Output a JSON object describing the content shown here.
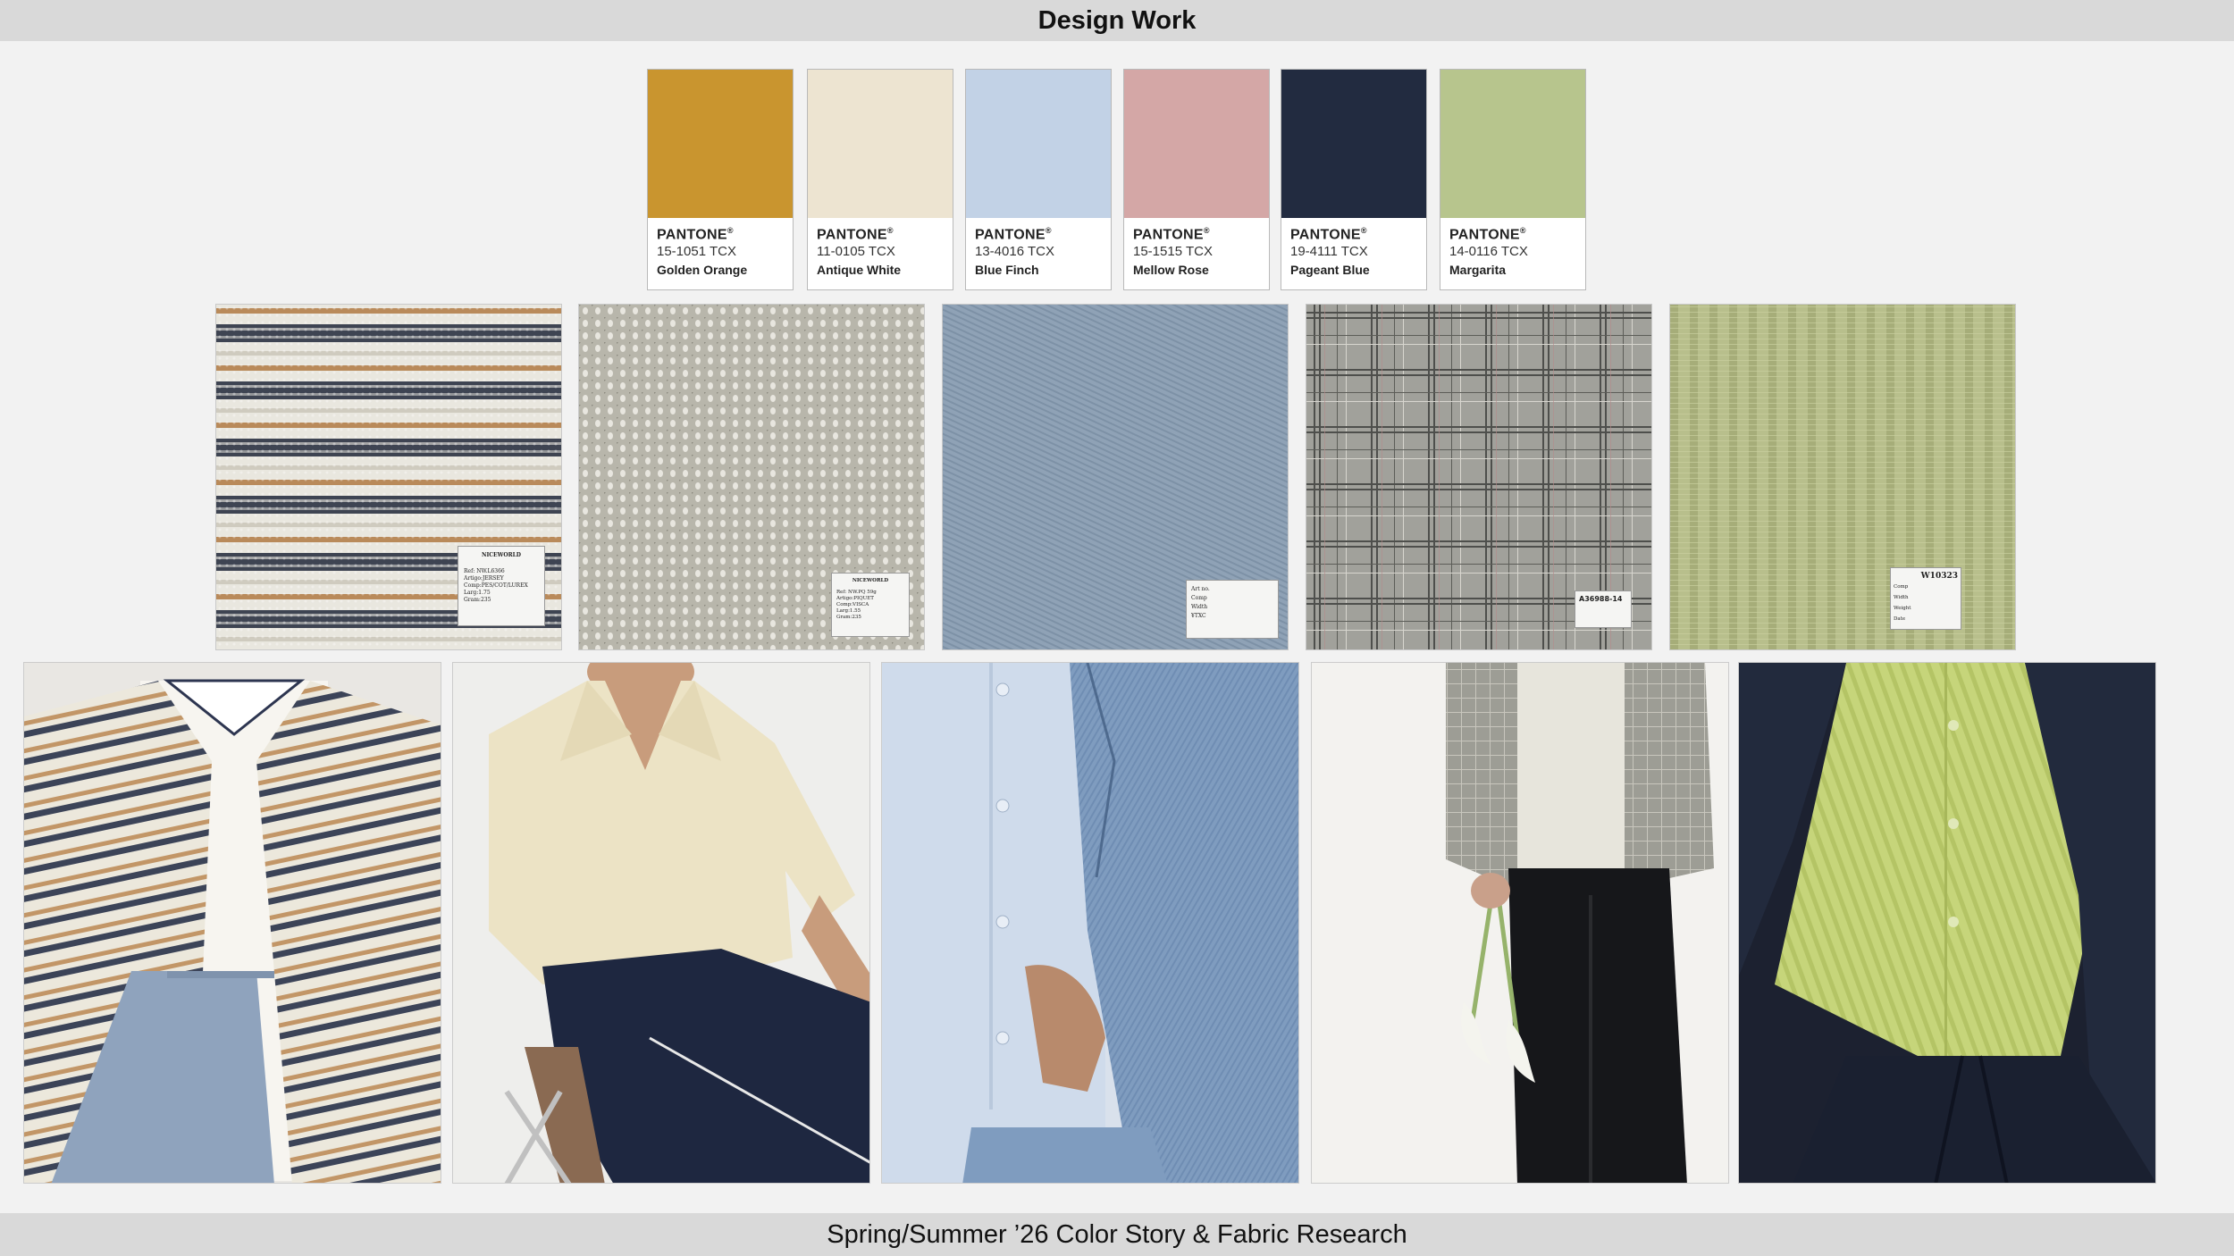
{
  "header": {
    "title": "Design Work"
  },
  "footer": {
    "caption": "Spring/Summer ’26 Color Story & Fabric Research"
  },
  "palette": [
    {
      "brand": "PANTONE",
      "code": "15-1051 TCX",
      "name": "Golden Orange",
      "color": "#C9952F"
    },
    {
      "brand": "PANTONE",
      "code": "11-0105 TCX",
      "name": "Antique White",
      "color": "#EDE4D1"
    },
    {
      "brand": "PANTONE",
      "code": "13-4016 TCX",
      "name": "Blue Finch",
      "color": "#C2D2E6"
    },
    {
      "brand": "PANTONE",
      "code": "15-1515 TCX",
      "name": "Mellow Rose",
      "color": "#D4A7A6"
    },
    {
      "brand": "PANTONE",
      "code": "19-4111 TCX",
      "name": "Pageant Blue",
      "color": "#222B40"
    },
    {
      "brand": "PANTONE",
      "code": "14-0116 TCX",
      "name": "Margarita",
      "color": "#B7C58D"
    }
  ],
  "fabrics": [
    {
      "texture": "striped-knit-icon",
      "tag": {
        "brand": "NICEWORLD",
        "lines": [
          "Ref: NW.L6366",
          "Artigo:JERSEY",
          "Comp:PES/COT/LUREX",
          "Larg:1.75",
          "Gram:235"
        ]
      }
    },
    {
      "texture": "pointelle-knit-icon",
      "tag": {
        "brand": "NICEWORLD",
        "lines": [
          "Ref: NW.PQ 59g",
          "Artigo:PIQUET",
          "Comp:VISCA",
          "Larg:1.55",
          "Gram:235"
        ]
      }
    },
    {
      "texture": "twill-icon",
      "tag": {
        "brand": "",
        "lines": [
          "Art no.",
          "Comp",
          "Width",
          "¥TXC"
        ]
      }
    },
    {
      "texture": "glen-plaid-icon",
      "tag": {
        "brand": "",
        "lines": [
          "A36988-14"
        ]
      }
    },
    {
      "texture": "seersucker-icon",
      "tag": {
        "brand": "W10323",
        "lines": [
          "Comp",
          "Width",
          "Weight",
          "Date"
        ]
      }
    }
  ],
  "looks": [
    {
      "description": "striped-overshirt-look"
    },
    {
      "description": "cream-knit-polo-look"
    },
    {
      "description": "blue-shirt-denim-jacket-look"
    },
    {
      "description": "grey-plaid-jacket-calla-lily-look"
    },
    {
      "description": "green-seersucker-shirt-navy-jacket-look"
    }
  ]
}
